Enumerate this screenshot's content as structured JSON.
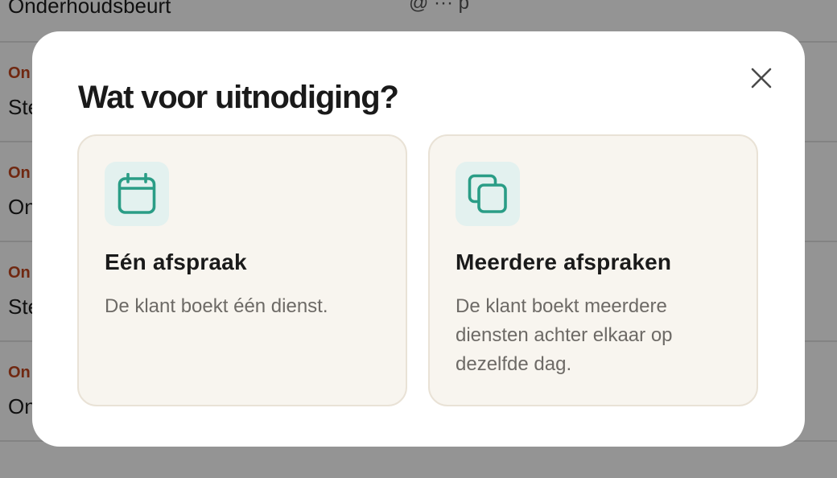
{
  "background": {
    "top_title": "Onderhoudsbeurt",
    "top_extra": "@ ··· p",
    "rows": [
      {
        "tag": "On",
        "name": "Ste"
      },
      {
        "tag": "On",
        "name": "On"
      },
      {
        "tag": "On",
        "name": "Ste"
      },
      {
        "tag": "On",
        "name": "On"
      }
    ]
  },
  "modal": {
    "title": "Wat voor uitnodiging?",
    "close_icon": "close-icon",
    "options": [
      {
        "icon": "calendar-icon",
        "title": "Eén afspraak",
        "description": "De klant boekt één dienst."
      },
      {
        "icon": "copy-icon",
        "title": "Meerdere afspraken",
        "description": "De klant boekt meerdere diensten achter elkaar op dezelfde dag."
      }
    ]
  },
  "colors": {
    "accent": "#2a9d86",
    "icon_bg": "#e3f1ef",
    "card_bg": "#f8f5ef",
    "tag": "#c2461e"
  }
}
